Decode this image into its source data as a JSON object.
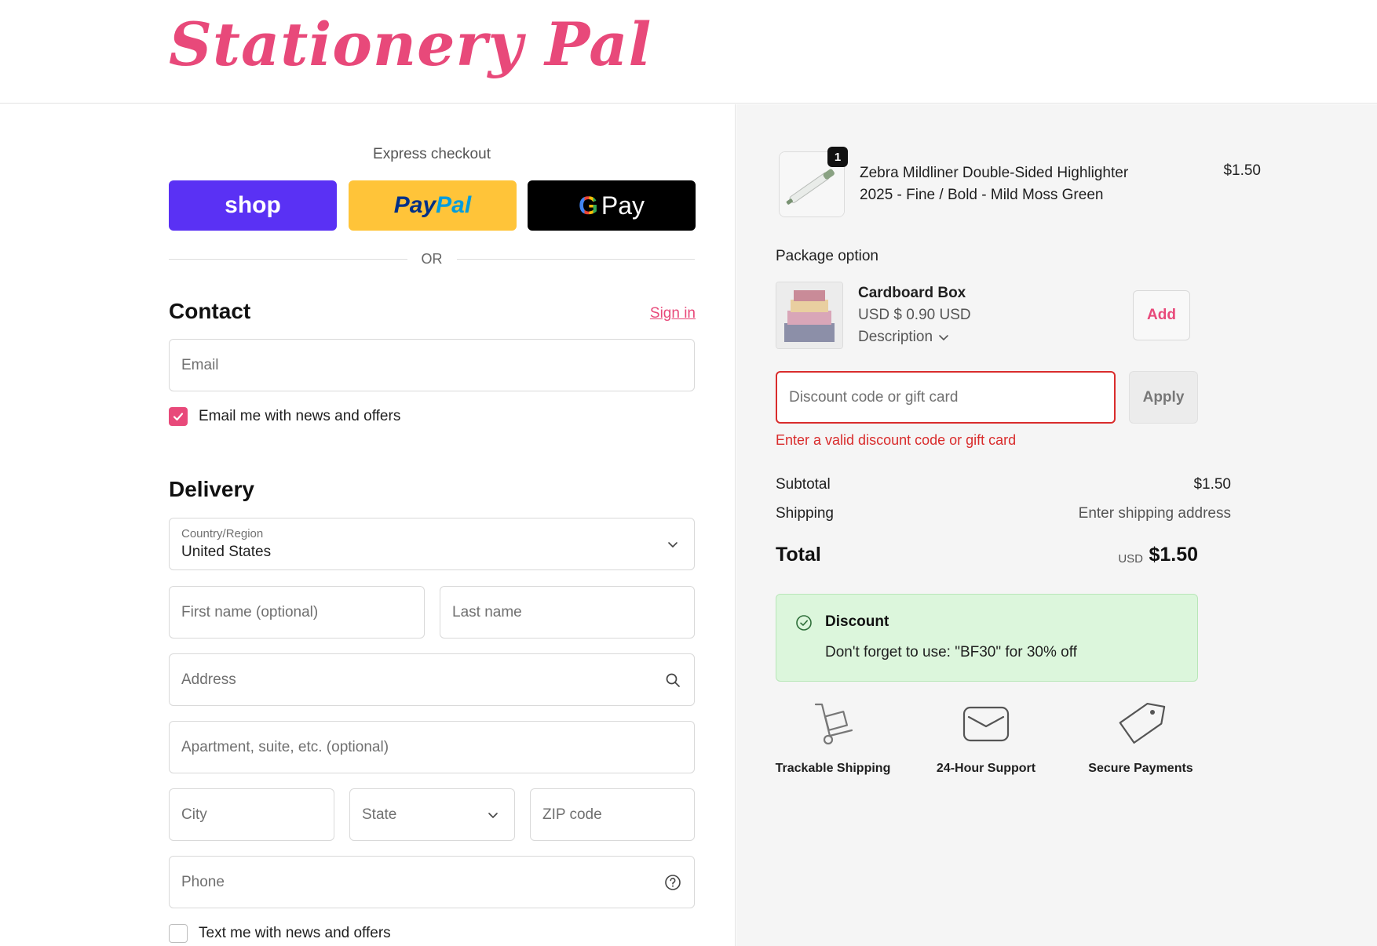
{
  "brand": {
    "name": "Stationery Pal"
  },
  "express_checkout": {
    "title": "Express checkout",
    "buttons": {
      "shop": "shop",
      "paypal_a": "Pay",
      "paypal_b": "Pal",
      "gpay": "Pay"
    },
    "or": "OR"
  },
  "contact": {
    "title": "Contact",
    "sign_in": "Sign in",
    "email_placeholder": "Email",
    "news_label": "Email me with news and offers",
    "news_checked": true
  },
  "delivery": {
    "title": "Delivery",
    "country_label": "Country/Region",
    "country_value": "United States",
    "first_name_placeholder": "First name (optional)",
    "last_name_placeholder": "Last name",
    "address_placeholder": "Address",
    "apartment_placeholder": "Apartment, suite, etc. (optional)",
    "city_placeholder": "City",
    "state_placeholder": "State",
    "zip_placeholder": "ZIP code",
    "phone_placeholder": "Phone",
    "text_label": "Text me with news and offers",
    "text_checked": false
  },
  "order": {
    "item": {
      "quantity": "1",
      "name": "Zebra Mildliner Double-Sided Highlighter 2025 - Fine / Bold - Mild Moss Green",
      "price": "$1.50"
    },
    "package": {
      "title": "Package option",
      "name": "Cardboard Box",
      "price": "USD $ 0.90 USD",
      "description": "Description",
      "add_label": "Add"
    },
    "discount": {
      "placeholder": "Discount code or gift card",
      "apply_label": "Apply",
      "error": "Enter a valid discount code or gift card"
    },
    "summary": {
      "subtotal_label": "Subtotal",
      "subtotal_value": "$1.50",
      "shipping_label": "Shipping",
      "shipping_value": "Enter shipping address",
      "total_label": "Total",
      "total_currency": "USD",
      "total_value": "$1.50"
    },
    "promo": {
      "title": "Discount",
      "text": "Don't forget to use: \"BF30\" for 30% off"
    },
    "features": [
      {
        "label": "Trackable Shipping",
        "icon": "hand-truck-icon"
      },
      {
        "label": "24-Hour Support",
        "icon": "envelope-icon"
      },
      {
        "label": "Secure Payments",
        "icon": "price-tag-icon"
      }
    ]
  },
  "colors": {
    "accent": "#e8497a",
    "error": "#d92c2c",
    "shop": "#5a31f4",
    "paypal": "#ffc439",
    "promo_bg": "#dcf6dc"
  }
}
